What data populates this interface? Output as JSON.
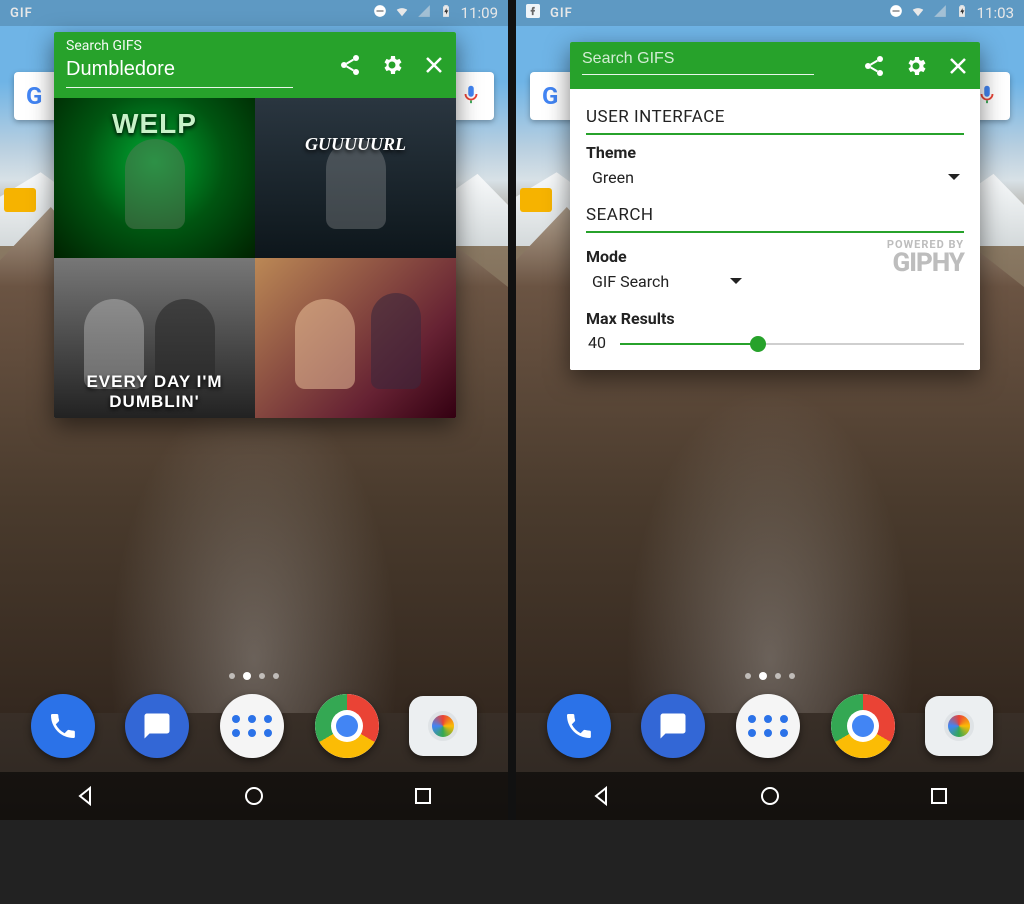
{
  "left": {
    "status": {
      "gif": "GIF",
      "time": "11:09"
    },
    "overlay": {
      "label": "Search GIFS",
      "query": "Dumbledore",
      "gifs": [
        {
          "caption": "WELP"
        },
        {
          "caption": "GUUUUURL"
        },
        {
          "caption": "EVERY DAY I'M DUMBLIN'"
        },
        {
          "caption": ""
        }
      ]
    }
  },
  "right": {
    "status": {
      "gif": "GIF",
      "time": "11:03"
    },
    "overlay": {
      "label": "Search GIFS",
      "query": "",
      "settings": {
        "section_ui": "USER INTERFACE",
        "theme_label": "Theme",
        "theme_value": "Green",
        "section_search": "SEARCH",
        "mode_label": "Mode",
        "mode_value": "GIF Search",
        "max_label": "Max Results",
        "max_value": "40",
        "powered_by": "POWERED BY",
        "giphy": "GIPHY"
      }
    }
  }
}
